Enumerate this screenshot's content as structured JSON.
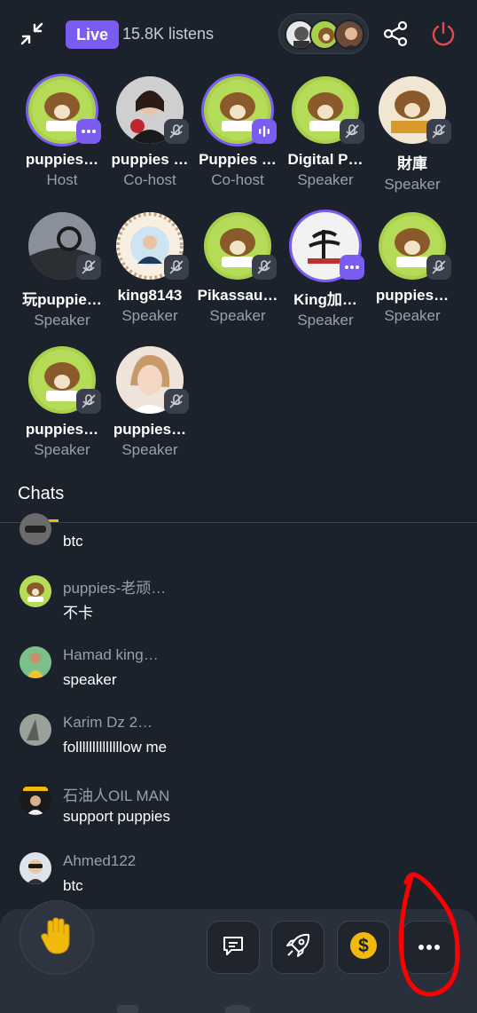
{
  "topbar": {
    "live_label": "Live",
    "listens": "15.8K listens"
  },
  "participants": [
    {
      "name": "puppies…",
      "role": "Host",
      "badge": "more-icon"
    },
    {
      "name": "puppies …",
      "role": "Co-host",
      "badge": "mic-off-icon"
    },
    {
      "name": "Puppies …",
      "role": "Co-host",
      "badge": "speaking-icon"
    },
    {
      "name": "Digital P…",
      "role": "Speaker",
      "badge": "mic-off-icon"
    },
    {
      "name": "財庫",
      "role": "Speaker",
      "badge": "mic-off-icon"
    },
    {
      "name": "玩puppie…",
      "role": "Speaker",
      "badge": "mic-off-icon"
    },
    {
      "name": "king8143",
      "role": "Speaker",
      "badge": "mic-off-icon"
    },
    {
      "name": "Pikassau…",
      "role": "Speaker",
      "badge": "mic-off-icon"
    },
    {
      "name": "King加…",
      "role": "Speaker",
      "badge": "more-icon"
    },
    {
      "name": "puppies…",
      "role": "Speaker",
      "badge": "mic-off-icon"
    },
    {
      "name": "puppies…",
      "role": "Speaker",
      "badge": "mic-off-icon"
    },
    {
      "name": "puppies…",
      "role": "Speaker",
      "badge": "mic-off-icon"
    }
  ],
  "chats": {
    "title": "Chats",
    "items": [
      {
        "user": "",
        "message": "btc"
      },
      {
        "user": "puppies-老顽…",
        "message": "不卡"
      },
      {
        "user": "Hamad king…",
        "message": "speaker"
      },
      {
        "user": "Karim Dz 2…",
        "message": "follllllllllllllow me"
      },
      {
        "user": "石油人OIL MAN",
        "message": "support puppies"
      },
      {
        "user": "Ahmed122",
        "message": "btc"
      }
    ]
  },
  "actions": {
    "raise_hand": "hand-icon",
    "chat": "chat-icon",
    "react": "rocket-icon",
    "tip": "dollar-icon",
    "more": "more-icon"
  },
  "colors": {
    "background": "#1c222c",
    "accent_purple": "#7b5cf0",
    "accent_yellow": "#f0b90b",
    "power_red": "#e5484d",
    "annotation_red": "#ff0000"
  }
}
